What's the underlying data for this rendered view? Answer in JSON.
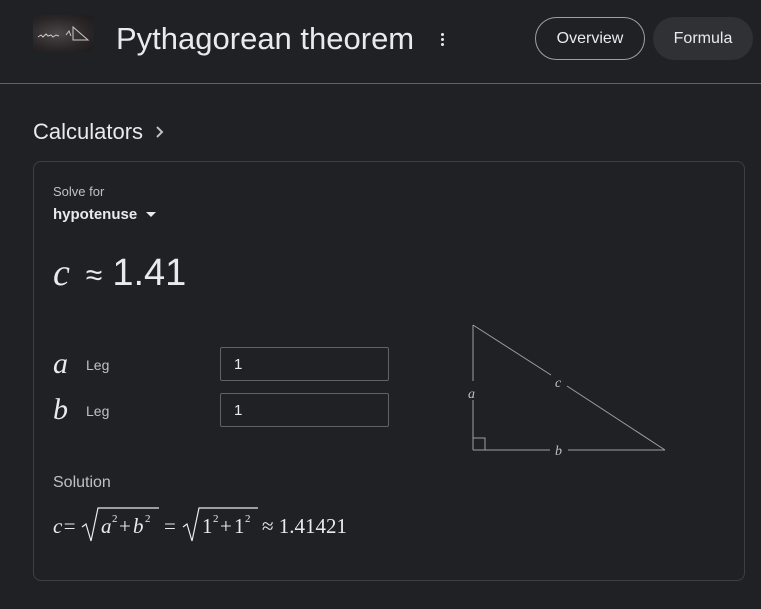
{
  "header": {
    "title": "Pythagorean theorem",
    "tabs": [
      {
        "label": "Overview",
        "selected": true
      },
      {
        "label": "Formula",
        "selected": false
      }
    ]
  },
  "calculators": {
    "heading": "Calculators",
    "solve_for_label": "Solve for",
    "solve_for_value": "hypotenuse",
    "result": {
      "variable": "c",
      "approx_symbol": "≈",
      "value": "1.41"
    },
    "inputs": [
      {
        "variable": "a",
        "label": "Leg",
        "value": "1"
      },
      {
        "variable": "b",
        "label": "Leg",
        "value": "1"
      }
    ],
    "diagram_labels": {
      "a": "a",
      "b": "b",
      "c": "c"
    },
    "solution_label": "Solution",
    "solution": {
      "lhs": "c=",
      "a": "a",
      "b": "b",
      "exp": "2",
      "n1": "1",
      "n2": "1",
      "result": "≈ 1.41421"
    }
  },
  "colors": {
    "background": "#202124",
    "text": "#e8eaed",
    "muted": "#bdc1c6",
    "border": "#5f6368"
  }
}
